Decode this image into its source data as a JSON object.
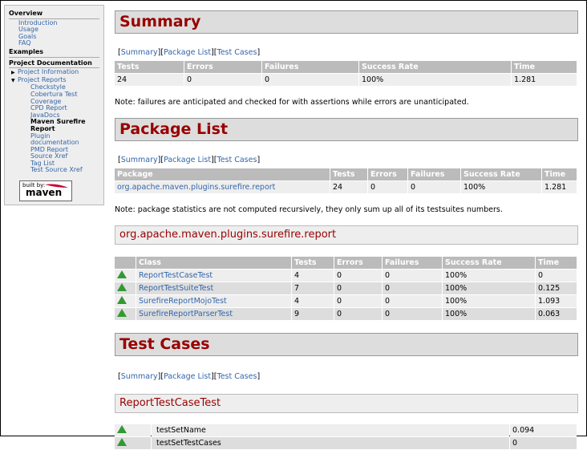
{
  "sidebar": {
    "overview": "Overview",
    "overview_items": [
      "Introduction",
      "Usage",
      "Goals",
      "FAQ"
    ],
    "examples": "Examples",
    "project_documentation": "Project Documentation",
    "project_information": "Project Information",
    "project_reports": "Project Reports",
    "reports": [
      "Checkstyle",
      "Cobertura Test",
      "Coverage",
      "CPD Report",
      "JavaDocs"
    ],
    "current": "Maven Surefire Report",
    "reports_after": [
      "Plugin documentation",
      "PMD Report",
      "Source Xref",
      "Tag List",
      "Test Source Xref"
    ],
    "badge_top": "built by:",
    "badge_logo": "maven"
  },
  "nav": {
    "summary": "Summary",
    "package_list": "Package List",
    "test_cases": "Test Cases"
  },
  "summary": {
    "title": "Summary",
    "headers": [
      "Tests",
      "Errors",
      "Failures",
      "Success Rate",
      "Time"
    ],
    "row": [
      "24",
      "0",
      "0",
      "100%",
      "1.281"
    ],
    "note": "Note: failures are anticipated and checked for with assertions while errors are unanticipated."
  },
  "packages": {
    "title": "Package List",
    "headers": [
      "Package",
      "Tests",
      "Errors",
      "Failures",
      "Success Rate",
      "Time"
    ],
    "row": [
      "org.apache.maven.plugins.surefire.report",
      "24",
      "0",
      "0",
      "100%",
      "1.281"
    ],
    "note": "Note: package statistics are not computed recursively, they only sum up all of its testsuites numbers."
  },
  "package_detail": {
    "title": "org.apache.maven.plugins.surefire.report",
    "headers": [
      "",
      "Class",
      "Tests",
      "Errors",
      "Failures",
      "Success Rate",
      "Time"
    ],
    "rows": [
      [
        "ReportTestCaseTest",
        "4",
        "0",
        "0",
        "100%",
        "0"
      ],
      [
        "ReportTestSuiteTest",
        "7",
        "0",
        "0",
        "100%",
        "0.125"
      ],
      [
        "SurefireReportMojoTest",
        "4",
        "0",
        "0",
        "100%",
        "1.093"
      ],
      [
        "SurefireReportParserTest",
        "9",
        "0",
        "0",
        "100%",
        "0.063"
      ]
    ]
  },
  "test_cases": {
    "title": "Test Cases",
    "suite": "ReportTestCaseTest",
    "rows": [
      [
        "testSetName",
        "0.094"
      ],
      [
        "testSetTestCases",
        "0"
      ]
    ]
  },
  "colors": {
    "heading": "#990000",
    "link": "#3366aa",
    "success": "#339933"
  }
}
